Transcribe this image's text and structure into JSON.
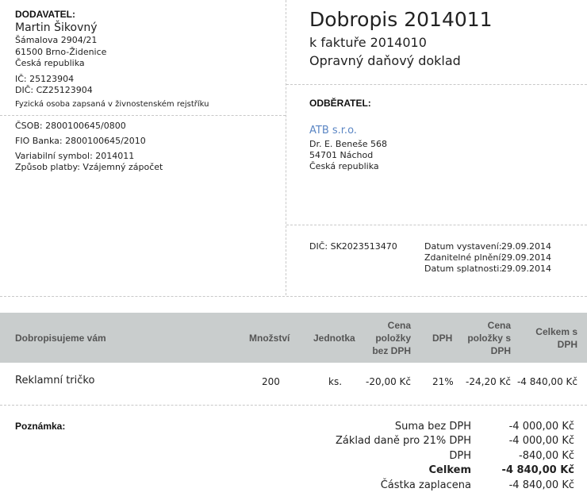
{
  "supplier": {
    "heading": "DODAVATEL:",
    "name": "Martin Šikovný",
    "street": "Šámalova 2904/21",
    "city": "61500 Brno-Židenice",
    "country": "Česká republika",
    "ic": "IČ: 25123904",
    "dic": "DIČ: CZ25123904",
    "note": "Fyzická osoba zapsaná v živnostenském rejstříku"
  },
  "payment": {
    "bank1": "ČSOB: 2800100645/0800",
    "bank2": "FIO Banka: 2800100645/2010",
    "variable_symbol": "Variabilní symbol: 2014011",
    "method": "Způsob platby: Vzájemný zápočet"
  },
  "document": {
    "title": "Dobropis 2014011",
    "invoice_ref": "k faktuře 2014010",
    "doc_type": "Opravný daňový doklad"
  },
  "customer": {
    "heading": "ODBĚRATEL:",
    "name": "ATB s.r.o.",
    "street": "Dr. E. Beneše 568",
    "city": "54701 Náchod",
    "country": "Česká republika",
    "dic": "DIČ: SK2023513470"
  },
  "dates": {
    "issued_label": "Datum vystavení:",
    "issued_value": "29.09.2014",
    "taxable_label": "Zdanitelné plnění:",
    "taxable_value": "29.09.2014",
    "due_label": "Datum splatnosti:",
    "due_value": "29.09.2014"
  },
  "table": {
    "headers": {
      "description": "Dobropisujeme vám",
      "quantity": "Množství",
      "unit": "Jednotka",
      "unit_price_1": "Cena",
      "unit_price_2": "položky",
      "unit_price_3": "bez DPH",
      "vat": "DPH",
      "price_vat_1": "Cena",
      "price_vat_2": "položky s",
      "price_vat_3": "DPH",
      "total_1": "Celkem s",
      "total_2": "DPH"
    },
    "rows": [
      {
        "description": "Reklamní tričko",
        "quantity": "200",
        "unit": "ks.",
        "unit_price": "-20,00 Kč",
        "vat": "21%",
        "price_vat": "-24,20 Kč",
        "total": "-4 840,00 Kč"
      }
    ]
  },
  "note": {
    "heading": "Poznámka:"
  },
  "summary": {
    "base_label": "Suma bez DPH",
    "base_value": "-4 000,00 Kč",
    "tax_base_label": "Základ daně pro 21% DPH",
    "tax_base_value": "-4 000,00 Kč",
    "vat_label": "DPH",
    "vat_value": "-840,00 Kč",
    "total_label": "Celkem",
    "total_value": "-4 840,00 Kč",
    "paid_label": "Částka zaplacena",
    "paid_value": "-4 840,00 Kč"
  }
}
